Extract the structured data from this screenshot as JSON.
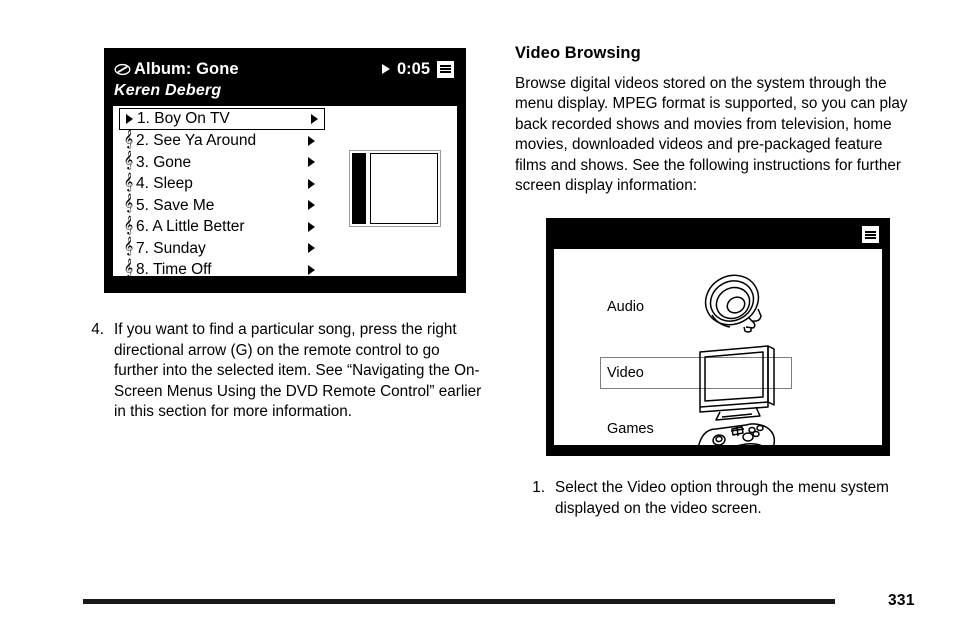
{
  "document": {
    "page_number": "331"
  },
  "left_column": {
    "album_screen": {
      "disc_icon": "disc-icon",
      "album_label": "Album: Gone",
      "artist": "Keren Deberg",
      "play_icon": "play-triangle-icon",
      "elapsed_time": "0:05",
      "menu_icon": "menu-list-icon",
      "tracks": [
        {
          "mark": "play",
          "label": "1. Boy On TV",
          "selected": true
        },
        {
          "mark": "note",
          "label": "2. See Ya Around",
          "selected": false
        },
        {
          "mark": "note",
          "label": "3. Gone",
          "selected": false
        },
        {
          "mark": "note",
          "label": "4. Sleep",
          "selected": false
        },
        {
          "mark": "note",
          "label": "5. Save Me",
          "selected": false
        },
        {
          "mark": "note",
          "label": "6. A Little Better",
          "selected": false
        },
        {
          "mark": "note",
          "label": "7. Sunday",
          "selected": false
        },
        {
          "mark": "note",
          "label": "8. Time Off",
          "selected": false
        }
      ],
      "album_art_alt": "album-cover-art"
    },
    "step": {
      "number": "4.",
      "text": "If you want to find a particular song, press the right directional arrow (G) on the remote control to go further into the selected item. See “Navigating the On-Screen Menus Using the DVD Remote Control” earlier in this section for more information."
    }
  },
  "right_column": {
    "heading": "Video Browsing",
    "paragraph": "Browse digital videos stored on the system through the menu display. MPEG format is supported, so you can play back recorded shows and movies from television, home movies, downloaded videos and pre-packaged feature films and shows. See the following instructions for further screen display information:",
    "video_screen": {
      "menu_icon": "menu-list-icon",
      "options": [
        {
          "label": "Audio",
          "icon": "speaker-icon",
          "selected": false
        },
        {
          "label": "Video",
          "icon": "television-icon",
          "selected": true
        },
        {
          "label": "Games",
          "icon": "game-controller-icon",
          "selected": false
        }
      ]
    },
    "step": {
      "number": "1.",
      "text": "Select the Video option through the menu system displayed on the video screen."
    }
  }
}
